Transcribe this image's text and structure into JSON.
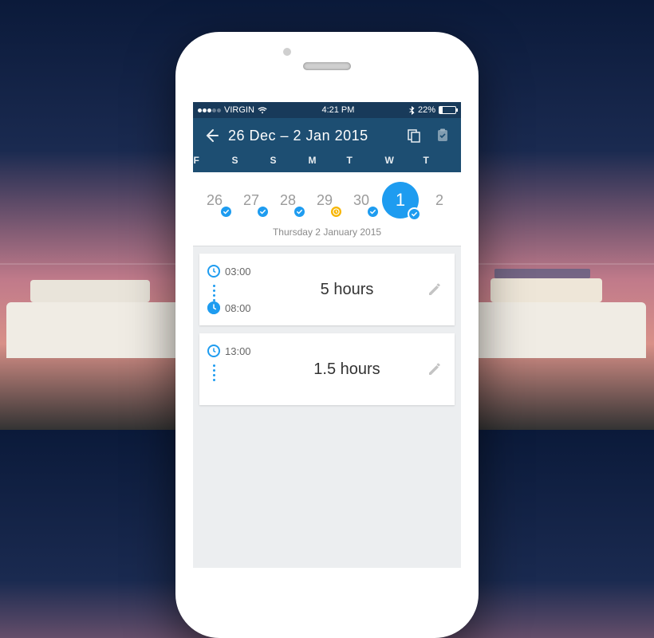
{
  "statusbar": {
    "carrier": "VIRGIN",
    "time": "4:21 PM",
    "battery_pct": "22%",
    "battery_fill_pct": 22
  },
  "header": {
    "title": "26 Dec – 2 Jan 2015",
    "weekday_labels": [
      "F",
      "S",
      "S",
      "M",
      "T",
      "W",
      "T"
    ]
  },
  "datestrip": {
    "days": [
      {
        "num": "26",
        "selected": false,
        "badge": "check"
      },
      {
        "num": "27",
        "selected": false,
        "badge": "check"
      },
      {
        "num": "28",
        "selected": false,
        "badge": "check"
      },
      {
        "num": "29",
        "selected": false,
        "badge": "pending"
      },
      {
        "num": "30",
        "selected": false,
        "badge": "check"
      },
      {
        "num": "1",
        "selected": true,
        "badge": "check"
      },
      {
        "num": "2",
        "selected": false,
        "badge": null
      }
    ],
    "selected_label": "Thursday 2 January 2015"
  },
  "entries": [
    {
      "start": "03:00",
      "end": "08:00",
      "duration": "5 hours"
    },
    {
      "start": "13:00",
      "end": "",
      "duration": "1.5 hours"
    }
  ],
  "icons": {
    "back": "back-arrow-icon",
    "copy": "copy-icon",
    "clipboard": "clipboard-icon",
    "wifi": "wifi-icon",
    "bt": "bluetooth-icon",
    "edit": "pencil-icon",
    "clock": "clock-icon"
  }
}
